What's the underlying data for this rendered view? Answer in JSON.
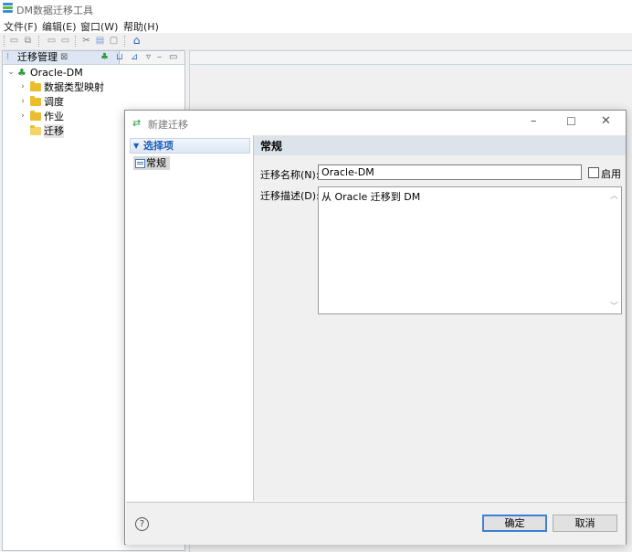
{
  "app": {
    "title": "DM数据迁移工具"
  },
  "menu": [
    "文件(F)",
    "编辑(E)",
    "窗口(W)",
    "帮助(H)"
  ],
  "left_panel": {
    "tab_label": "迁移管理",
    "tab_close": "⊠",
    "tree": {
      "root": "Oracle-DM",
      "children": [
        "数据类型映射",
        "调度",
        "作业",
        "迁移"
      ],
      "selected": "迁移"
    }
  },
  "dialog": {
    "title": "新建迁移",
    "nav": {
      "group_label": "选择项",
      "item_label": "常规"
    },
    "section_title": "常规",
    "fields": {
      "name_label": "迁移名称(N):",
      "name_value": "Oracle-DM",
      "enable_label": "启用",
      "enable_checked": false,
      "desc_label": "迁移描述(D):",
      "desc_value": "从 Oracle 迁移到 DM"
    },
    "buttons": {
      "ok": "确定",
      "cancel": "取消",
      "help": "?"
    }
  },
  "colors": {
    "accent": "#1e5fb8",
    "folder": "#ebbd2e",
    "tree_root_icon": "#2b9a3e"
  }
}
